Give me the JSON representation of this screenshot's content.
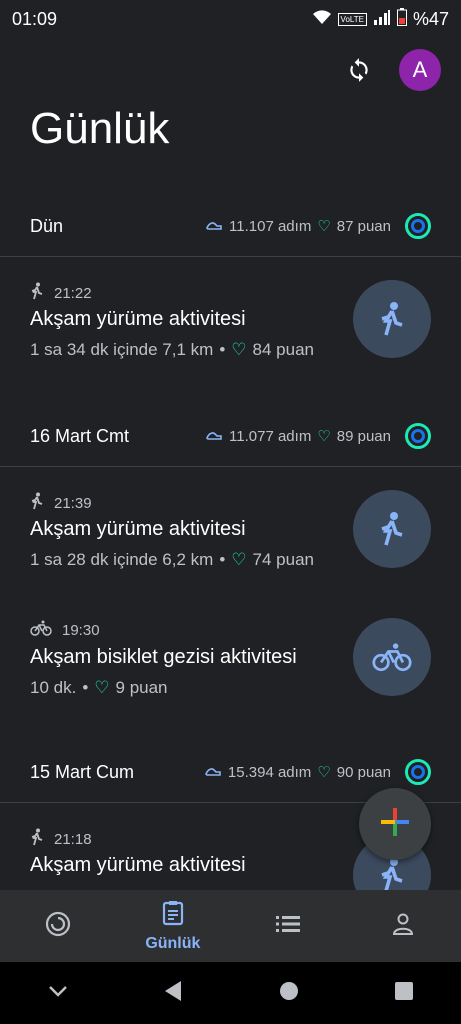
{
  "status": {
    "time": "01:09",
    "network": "VoLTE",
    "battery": "%47"
  },
  "header": {
    "sync_icon": "sync-icon",
    "avatar_letter": "A",
    "title": "Günlük",
    "accent_color": "#8ab4f8"
  },
  "days": [
    {
      "label": "Dün",
      "steps": "11.107 adım",
      "points": "87 puan",
      "activities": [
        {
          "time": "21:22",
          "type": "walk",
          "title": "Akşam yürüme aktivitesi",
          "summary": "1 sa 34 dk içinde 7,1 km",
          "points": "84 puan"
        }
      ]
    },
    {
      "label": "16 Mart Cmt",
      "steps": "11.077 adım",
      "points": "89 puan",
      "activities": [
        {
          "time": "21:39",
          "type": "walk",
          "title": "Akşam yürüme aktivitesi",
          "summary": "1 sa 28 dk içinde 6,2 km",
          "points": "74 puan"
        },
        {
          "time": "19:30",
          "type": "bike",
          "title": "Akşam bisiklet gezisi aktivitesi",
          "summary": "10 dk.",
          "points": "9 puan"
        }
      ]
    },
    {
      "label": "15 Mart Cum",
      "steps": "15.394 adım",
      "points": "90 puan",
      "activities": [
        {
          "time": "21:18",
          "type": "walk",
          "title": "Akşam yürüme aktivitesi",
          "summary": "",
          "points": ""
        }
      ]
    }
  ],
  "bottom_nav": [
    {
      "icon": "home-ring-icon",
      "label": ""
    },
    {
      "icon": "journal-icon",
      "label": "Günlük",
      "active": true
    },
    {
      "icon": "list-icon",
      "label": ""
    },
    {
      "icon": "profile-icon",
      "label": ""
    }
  ]
}
